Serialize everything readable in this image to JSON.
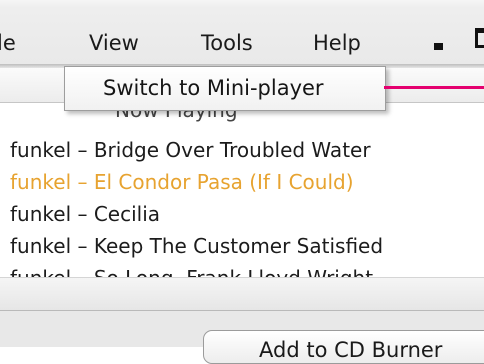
{
  "menubar": {
    "items": [
      "le",
      "View",
      "Tools",
      "Help"
    ]
  },
  "tabstrip": {
    "label": "Now Playing"
  },
  "dropdown": {
    "item": "Switch to Mini-player"
  },
  "tracks": [
    {
      "text": "funkel – Bridge Over Troubled Water",
      "playing": false
    },
    {
      "text": "funkel – El Condor Pasa (If I Could)",
      "playing": true
    },
    {
      "text": "funkel – Cecilia",
      "playing": false
    },
    {
      "text": "funkel – Keep The Customer Satisfied",
      "playing": false
    },
    {
      "text": "funkel – So Long, Frank Lloyd Wright",
      "playing": false
    }
  ],
  "bottom": {
    "cd_button_label": "Add to CD Burner"
  },
  "colors": {
    "callout": "#e4006f",
    "playing": "#e7a330"
  }
}
